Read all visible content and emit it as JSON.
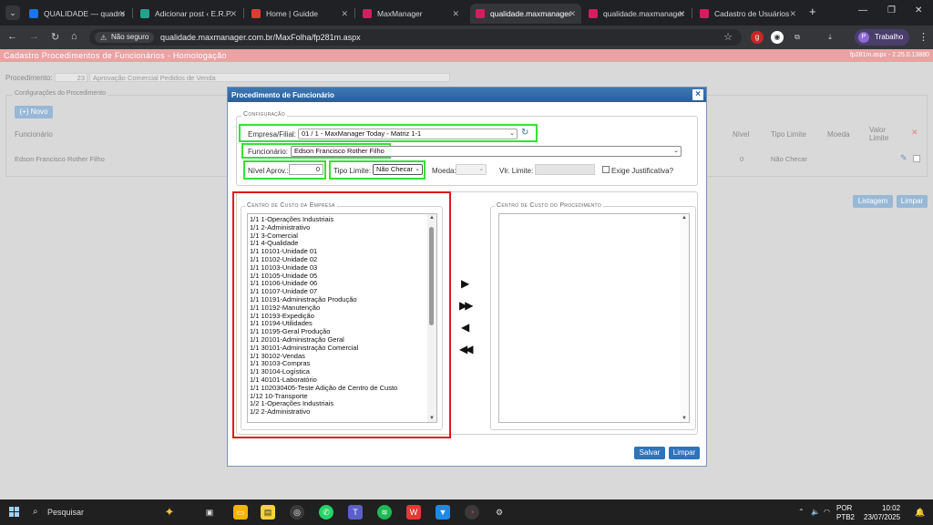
{
  "browser": {
    "tabs": [
      {
        "label": "QUALIDADE — quadro",
        "color": "#1a73e8"
      },
      {
        "label": "Adicionar post ‹ E.R.P.",
        "color": "#21a38b"
      },
      {
        "label": "Home | Guidde",
        "color": "#e53935"
      },
      {
        "label": "MaxManager",
        "color": "#d81b60"
      },
      {
        "label": "qualidade.maxmanager",
        "color": "#d81b60"
      },
      {
        "label": "qualidade.maxmanager",
        "color": "#d81b60"
      },
      {
        "label": "Cadastro de Usuários",
        "color": "#d81b60"
      }
    ],
    "active_tab": 4,
    "not_secure": "Não seguro",
    "url": "qualidade.maxmanager.com.br/MaxFolha/fp281m.aspx",
    "profile": "Trabalho",
    "profile_initial": "P"
  },
  "background_page": {
    "title": "Cadastro Procedimentos de Funcionários - Homologação",
    "version": "fp281m.aspx - 2.25.0.13880",
    "procedimento_label": "Procedimento:",
    "procedimento_code": "23",
    "procedimento_name": "Aprovação Comercial Pedidos de Venda",
    "config_legend": "Configurações do Procedimento",
    "novo_button": "(+) Novo",
    "col_funcionario": "Funcionário",
    "col_nivel": "Nível",
    "col_tipo_limite": "Tipo Limite",
    "col_moeda": "Moeda",
    "col_valor_limite": "Valor Limite",
    "row_funcionario": "Edson Francisco Rother Filho",
    "row_nivel": "0",
    "row_tipo": "Não Checar",
    "listagem_button": "Listagem",
    "limpar_button": "Limpar"
  },
  "modal": {
    "title": "Procedimento de Funcionário",
    "config_legend": "Configuração",
    "empresa_label": "Empresa/Filial:",
    "empresa_value": "01 / 1 - MaxManager Today - Matriz 1-1",
    "funcionario_label": "Funcionário:",
    "funcionario_value": "Edson Francisco Rother Filho",
    "nivel_label": "Nível Aprov.:",
    "nivel_value": "0",
    "tipo_label": "Tipo Limite:",
    "tipo_value": "Não Checar",
    "moeda_label": "Moeda:",
    "vlr_label": "Vlr. Limite:",
    "exige_label": "Exige Justificativa?",
    "cc_empresa_legend": "Centro de Custo da Empresa",
    "cc_proc_legend": "Centro de Custo do Procedimento",
    "cc_empresa_items": [
      "1/1 1-Operações Industriais",
      "1/1 2-Administrativo",
      "1/1 3-Comercial",
      "1/1 4-Qualidade",
      "1/1 10101-Unidade 01",
      "1/1 10102-Unidade 02",
      "1/1 10103-Unidade 03",
      "1/1 10105-Unidade 05",
      "1/1 10106-Unidade 06",
      "1/1 10107-Unidade 07",
      "1/1 10191-Administração Produção",
      "1/1 10192-Manutenção",
      "1/1 10193-Expedição",
      "1/1 10194-Utilidades",
      "1/1 10195-Geral Produção",
      "1/1 20101-Administração Geral",
      "1/1 30101-Administração Comercial",
      "1/1 30102-Vendas",
      "1/1 30103-Compras",
      "1/1 30104-Logística",
      "1/1 40101-Laboratório",
      "1/1 102030405-Teste Adição de Centro de Custo",
      "1/12 10-Transporte",
      "1/2 1-Operações Industriais",
      "1/2 2-Administrativo"
    ],
    "salvar_button": "Salvar",
    "limpar_button": "Limpar"
  },
  "taskbar": {
    "search_placeholder": "Pesquisar",
    "lang": "POR",
    "lang2": "PTB2",
    "time": "10:02",
    "date": "23/07/2025"
  },
  "colors": {
    "header_pink": "#e8a3a3",
    "modal_blue": "#2f73bb",
    "highlight_green": "#35e035",
    "highlight_red": "#e01818"
  }
}
